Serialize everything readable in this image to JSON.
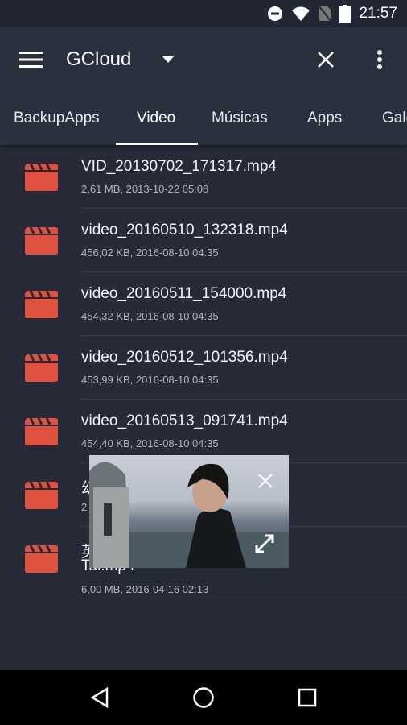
{
  "status_bar": {
    "time": "21:57",
    "icons": [
      "do-not-disturb-icon",
      "wifi-icon",
      "no-sim-icon",
      "battery-icon"
    ]
  },
  "toolbar": {
    "title": "GCloud",
    "icons": [
      "menu-icon",
      "dropdown-arrow-icon",
      "close-icon",
      "more-vert-icon"
    ]
  },
  "tabs": [
    {
      "label": "BackupApps"
    },
    {
      "label": "Video",
      "active": true
    },
    {
      "label": "Músicas"
    },
    {
      "label": "Apps"
    },
    {
      "label": "Gale"
    }
  ],
  "files": [
    {
      "name": "VID_20130702_171317.mp4",
      "meta": "2,61 MB, 2013-10-22 05:08"
    },
    {
      "name": "video_20160510_132318.mp4",
      "meta": "456,02 KB, 2016-08-10 04:35"
    },
    {
      "name": "video_20160511_154000.mp4",
      "meta": "454,32 KB, 2016-08-10 04:35"
    },
    {
      "name": "video_20160512_101356.mp4",
      "meta": "453,99 KB, 2016-08-10 04:35"
    },
    {
      "name": "video_20160513_091741.mp4",
      "meta": "454,40 KB, 2016-08-10 04:35"
    },
    {
      "name": "幻                           Tai.mp4",
      "meta": "2"
    },
    {
      "name": "英                          --",
      "name2": "Tai.mp4",
      "meta": "6,00 MB, 2016-04-16 02:13"
    }
  ],
  "colors": {
    "accent": "#e0513f",
    "background": "#262b37",
    "toolbar": "#2b303e"
  },
  "pip": {
    "icons": [
      "close-icon",
      "expand-icon"
    ]
  }
}
